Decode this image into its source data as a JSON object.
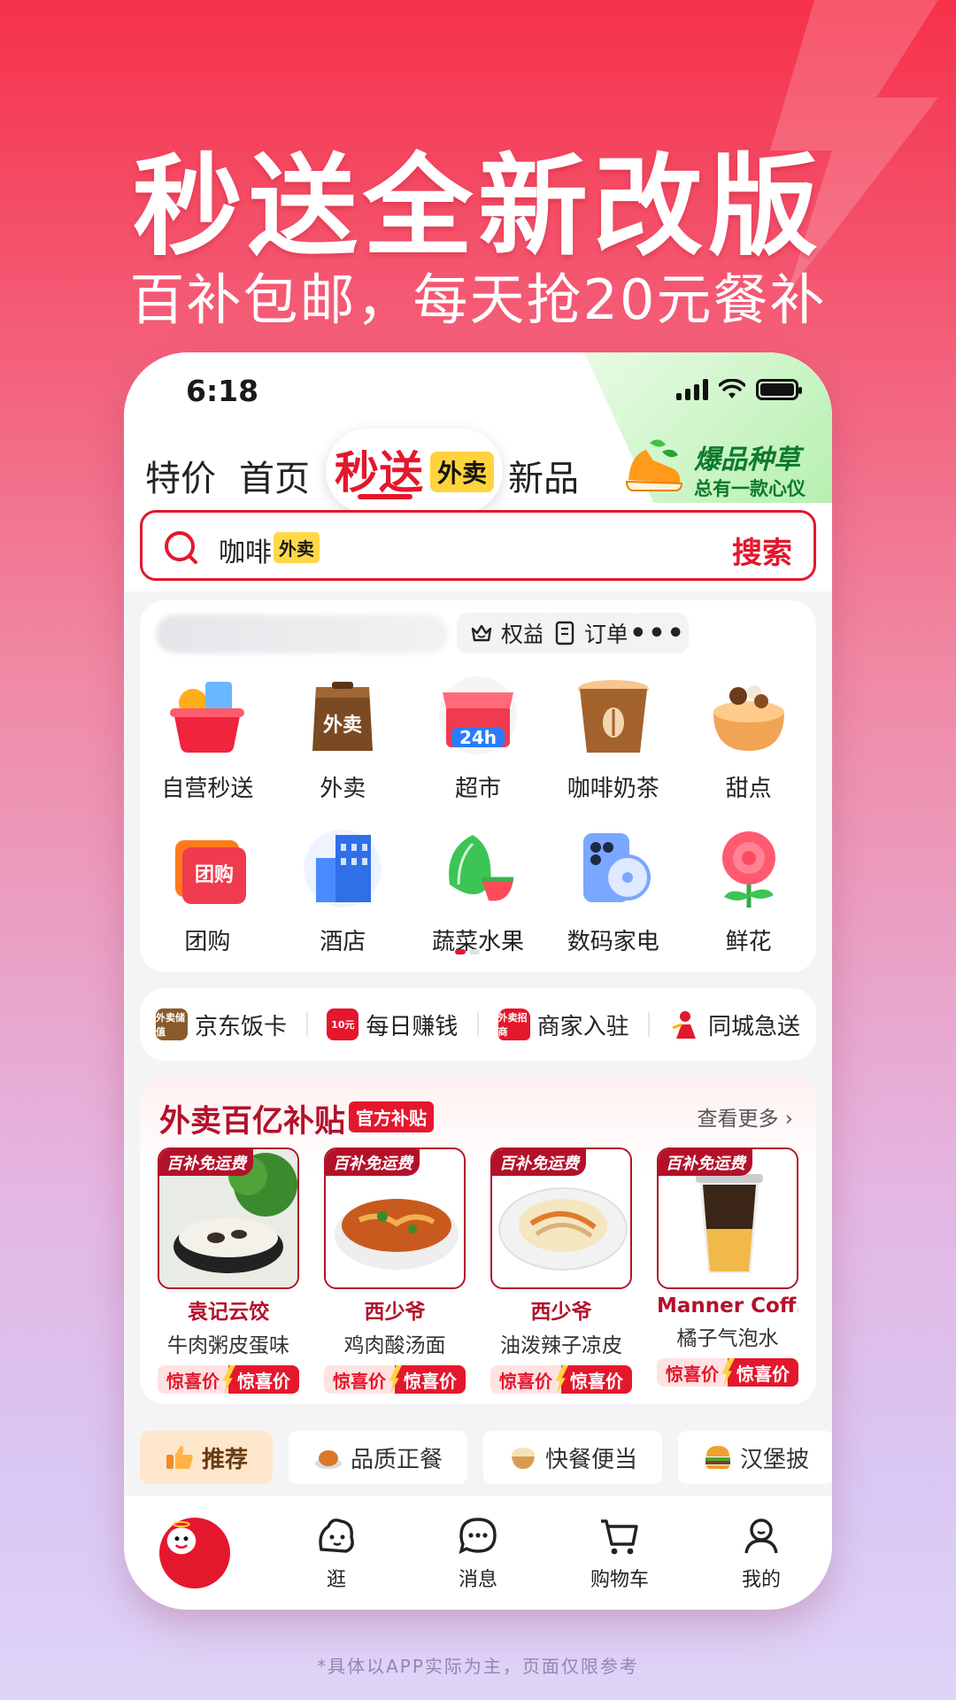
{
  "promo": {
    "title": "秒送全新改版",
    "subtitle": "百补包邮，每天抢20元餐补"
  },
  "status_bar": {
    "time": "6:18"
  },
  "top_tabs": {
    "tab1": "特价",
    "tab2": "首页",
    "active": "秒送",
    "active_badge": "外卖",
    "tab4": "新品",
    "promo_line1": "爆品种草",
    "promo_line2": "总有一款心仪"
  },
  "search": {
    "value": "咖啡",
    "tag": "外卖",
    "button": "搜索"
  },
  "quick_actions": {
    "benefits": "权益",
    "orders": "订单"
  },
  "categories": [
    {
      "label": "自营秒送",
      "icon": "basket-icon"
    },
    {
      "label": "外卖",
      "icon": "takeout-bag-icon"
    },
    {
      "label": "超市",
      "icon": "supermarket-24h-icon"
    },
    {
      "label": "咖啡奶茶",
      "icon": "coffee-cup-icon"
    },
    {
      "label": "甜点",
      "icon": "cake-icon"
    },
    {
      "label": "团购",
      "icon": "group-buy-ticket-icon"
    },
    {
      "label": "酒店",
      "icon": "hotel-building-icon"
    },
    {
      "label": "蔬菜水果",
      "icon": "vegetable-fruit-icon"
    },
    {
      "label": "数码家电",
      "icon": "phone-fan-icon"
    },
    {
      "label": "鲜花",
      "icon": "rose-icon"
    }
  ],
  "category_icon_text": {
    "takeout": "外卖",
    "supermarket": "24h",
    "groupbuy": "团购"
  },
  "links": [
    {
      "label": "京东饭卡",
      "icon_text": "外卖储值",
      "color": "#8a5a2b"
    },
    {
      "label": "每日赚钱",
      "icon_text": "10元",
      "color": "#e4172d"
    },
    {
      "label": "商家入驻",
      "icon_text": "外卖招商",
      "color": "#e4172d"
    },
    {
      "label": "同城急送",
      "icon_text": "",
      "color": "#e4172d"
    }
  ],
  "subsidy": {
    "title": "外卖百亿补贴",
    "badge": "官方补贴",
    "more": "查看更多 ›",
    "ribbon": "百补免运费",
    "price_a": "惊喜价",
    "price_b": "惊喜价",
    "products": [
      {
        "name": "袁记云饺",
        "desc": "牛肉粥皮蛋味"
      },
      {
        "name": "西少爷",
        "desc": "鸡肉酸汤面"
      },
      {
        "name": "西少爷",
        "desc": "油泼辣子凉皮"
      },
      {
        "name": "Manner Coff...",
        "desc": "橘子气泡水"
      }
    ]
  },
  "filter_chips": [
    {
      "label": "推荐",
      "active": true
    },
    {
      "label": "品质正餐",
      "active": false
    },
    {
      "label": "快餐便当",
      "active": false
    },
    {
      "label": "汉堡披",
      "active": false
    }
  ],
  "bottom_nav": [
    {
      "label": "",
      "icon": "jd-mascot-icon"
    },
    {
      "label": "逛",
      "icon": "browse-icon"
    },
    {
      "label": "消息",
      "icon": "message-icon"
    },
    {
      "label": "购物车",
      "icon": "cart-icon"
    },
    {
      "label": "我的",
      "icon": "profile-icon"
    }
  ],
  "disclaimer": "*具体以APP实际为主，页面仅限参考",
  "colors": {
    "brand_red": "#e4172d",
    "dark_red": "#b3112a",
    "yellow": "#ffd33d",
    "green": "#0c7a2c"
  }
}
